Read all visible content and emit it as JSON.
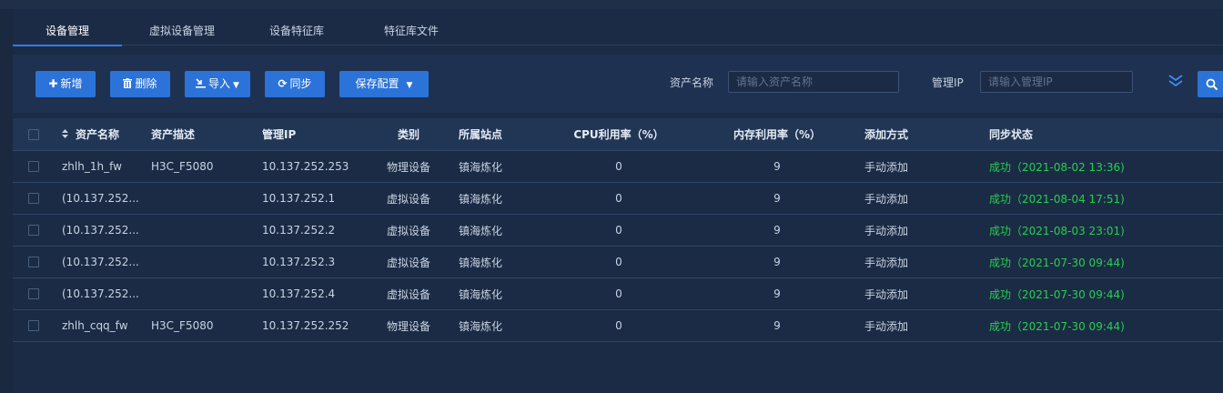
{
  "tabs": [
    {
      "label": "设备管理",
      "active": true
    },
    {
      "label": "虚拟设备管理",
      "active": false
    },
    {
      "label": "设备特征库",
      "active": false
    },
    {
      "label": "特征库文件",
      "active": false
    }
  ],
  "toolbar": {
    "add_label": "新增",
    "delete_label": "删除",
    "import_label": "导入",
    "sync_label": "同步",
    "save_config_label": "保存配置"
  },
  "filters": {
    "asset_name_label": "资产名称",
    "asset_name_placeholder": "请输入资产名称",
    "mgmt_ip_label": "管理IP",
    "mgmt_ip_placeholder": "请输入管理IP"
  },
  "table": {
    "headers": {
      "name": "资产名称",
      "desc": "资产描述",
      "ip": "管理IP",
      "type": "类别",
      "site": "所属站点",
      "cpu": "CPU利用率（%）",
      "mem": "内存利用率（%）",
      "add_method": "添加方式",
      "sync": "同步状态"
    },
    "rows": [
      {
        "name": "zhlh_1h_fw",
        "desc": "H3C_F5080",
        "ip": "10.137.252.253",
        "type": "物理设备",
        "site": "镇海炼化",
        "cpu": "0",
        "mem": "9",
        "add_method": "手动添加",
        "sync": "成功（2021-08-02 13:36)"
      },
      {
        "name": "(10.137.252...",
        "desc": "",
        "ip": "10.137.252.1",
        "type": "虚拟设备",
        "site": "镇海炼化",
        "cpu": "0",
        "mem": "9",
        "add_method": "手动添加",
        "sync": "成功（2021-08-04 17:51)"
      },
      {
        "name": "(10.137.252...",
        "desc": "",
        "ip": "10.137.252.2",
        "type": "虚拟设备",
        "site": "镇海炼化",
        "cpu": "0",
        "mem": "9",
        "add_method": "手动添加",
        "sync": "成功（2021-08-03 23:01)"
      },
      {
        "name": "(10.137.252...",
        "desc": "",
        "ip": "10.137.252.3",
        "type": "虚拟设备",
        "site": "镇海炼化",
        "cpu": "0",
        "mem": "9",
        "add_method": "手动添加",
        "sync": "成功（2021-07-30 09:44)"
      },
      {
        "name": "(10.137.252...",
        "desc": "",
        "ip": "10.137.252.4",
        "type": "虚拟设备",
        "site": "镇海炼化",
        "cpu": "0",
        "mem": "9",
        "add_method": "手动添加",
        "sync": "成功（2021-07-30 09:44)"
      },
      {
        "name": "zhlh_cqq_fw",
        "desc": "H3C_F5080",
        "ip": "10.137.252.252",
        "type": "物理设备",
        "site": "镇海炼化",
        "cpu": "0",
        "mem": "9",
        "add_method": "手动添加",
        "sync": "成功（2021-07-30 09:44)"
      }
    ]
  },
  "colors": {
    "accent": "#2b73d8",
    "success": "#25d04d",
    "background": "#1b2b45"
  },
  "icons": {
    "add": "plus-icon",
    "delete": "trash-icon",
    "import": "import-icon",
    "sync": "refresh-icon",
    "save": "caret-down-icon",
    "collapse": "double-chevron-down-icon",
    "search": "search-icon"
  }
}
